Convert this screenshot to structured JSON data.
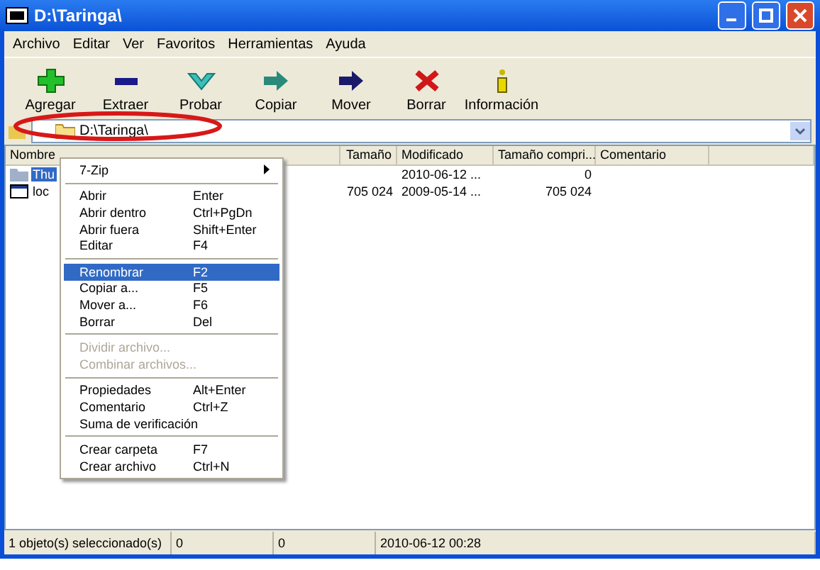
{
  "window": {
    "title": "D:\\Taringa\\"
  },
  "menu_bar": [
    "Archivo",
    "Editar",
    "Ver",
    "Favoritos",
    "Herramientas",
    "Ayuda"
  ],
  "toolbar": [
    {
      "label": "Agregar",
      "kind": "plus"
    },
    {
      "label": "Extraer",
      "kind": "minus"
    },
    {
      "label": "Probar",
      "kind": "check"
    },
    {
      "label": "Copiar",
      "kind": "copy"
    },
    {
      "label": "Mover",
      "kind": "move"
    },
    {
      "label": "Borrar",
      "kind": "delete"
    },
    {
      "label": "Información",
      "kind": "info"
    }
  ],
  "address": {
    "value": "D:\\Taringa\\"
  },
  "table": {
    "columns": [
      "Nombre",
      "Tamaño",
      "Modificado",
      "Tamaño compri...",
      "Comentario"
    ],
    "rows": [
      {
        "kind": "folder",
        "name": "Thu",
        "size": "",
        "modified": "2010-06-12 ...",
        "packed": "0",
        "selected": true
      },
      {
        "kind": "file",
        "name": "loc",
        "size": "705 024",
        "modified": "2009-05-14 ...",
        "packed": "705 024",
        "selected": false
      }
    ]
  },
  "context_menu": [
    {
      "kind": "submenu",
      "label": "7-Zip",
      "disabled": false,
      "selected": false
    },
    {
      "kind": "sep"
    },
    {
      "kind": "item",
      "label": "Abrir",
      "shortcut": "Enter",
      "disabled": false,
      "selected": false
    },
    {
      "kind": "item",
      "label": "Abrir dentro",
      "shortcut": "Ctrl+PgDn",
      "disabled": false,
      "selected": false
    },
    {
      "kind": "item",
      "label": "Abrir fuera",
      "shortcut": "Shift+Enter",
      "disabled": false,
      "selected": false
    },
    {
      "kind": "item",
      "label": "Editar",
      "shortcut": "F4",
      "disabled": false,
      "selected": false
    },
    {
      "kind": "sep"
    },
    {
      "kind": "item",
      "label": "Renombrar",
      "shortcut": "F2",
      "disabled": false,
      "selected": true
    },
    {
      "kind": "item",
      "label": "Copiar a...",
      "shortcut": "F5",
      "disabled": false,
      "selected": false
    },
    {
      "kind": "item",
      "label": "Mover a...",
      "shortcut": "F6",
      "disabled": false,
      "selected": false
    },
    {
      "kind": "item",
      "label": "Borrar",
      "shortcut": "Del",
      "disabled": false,
      "selected": false
    },
    {
      "kind": "sep"
    },
    {
      "kind": "item",
      "label": "Dividir archivo...",
      "disabled": true,
      "selected": false
    },
    {
      "kind": "item",
      "label": "Combinar archivos...",
      "disabled": true,
      "selected": false
    },
    {
      "kind": "sep"
    },
    {
      "kind": "item",
      "label": "Propiedades",
      "shortcut": "Alt+Enter",
      "disabled": false,
      "selected": false
    },
    {
      "kind": "item",
      "label": "Comentario",
      "shortcut": "Ctrl+Z",
      "disabled": false,
      "selected": false
    },
    {
      "kind": "item",
      "label": "Suma de verificación",
      "disabled": false,
      "selected": false
    },
    {
      "kind": "sep"
    },
    {
      "kind": "item",
      "label": "Crear carpeta",
      "shortcut": "F7",
      "disabled": false,
      "selected": false
    },
    {
      "kind": "item",
      "label": "Crear archivo",
      "shortcut": "Ctrl+N",
      "disabled": false,
      "selected": false
    }
  ],
  "status_bar": [
    "1 objeto(s) seleccionado(s)",
    "0",
    "0",
    "2010-06-12 00:28"
  ]
}
